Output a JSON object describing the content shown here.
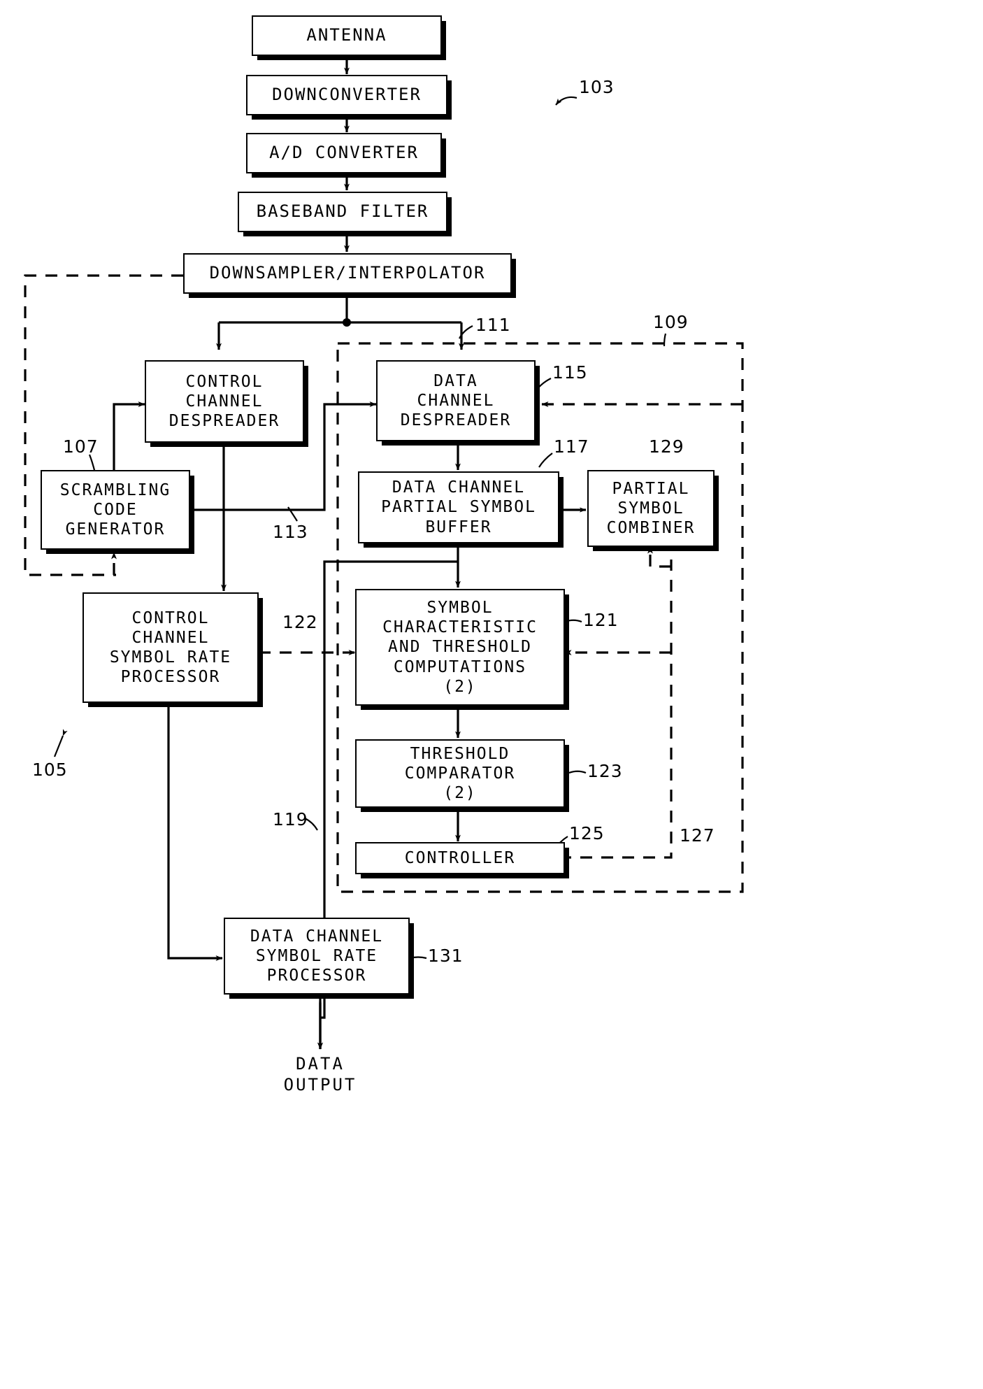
{
  "figure": {
    "title": "Receiver block diagram",
    "stroke_color": "#000000",
    "background_color": "#ffffff"
  },
  "blocks": [
    {
      "id": "antenna",
      "label": "ANTENNA"
    },
    {
      "id": "downconverter",
      "label": "DOWNCONVERTER"
    },
    {
      "id": "ad_converter",
      "label": "A/D CONVERTER"
    },
    {
      "id": "baseband_filter",
      "label": "BASEBAND FILTER"
    },
    {
      "id": "downsampler",
      "label": "DOWNSAMPLER/INTERPOLATOR"
    },
    {
      "id": "control_despreader",
      "label": "CONTROL\nCHANNEL\nDESPREADER"
    },
    {
      "id": "data_despreader",
      "label": "DATA\nCHANNEL\nDESPREADER"
    },
    {
      "id": "scrambling_code",
      "label": "SCRAMBLING\nCODE\nGENERATOR"
    },
    {
      "id": "partial_symbol_buffer",
      "label": "DATA CHANNEL\nPARTIAL SYMBOL\nBUFFER"
    },
    {
      "id": "partial_symbol_combiner",
      "label": "PARTIAL\nSYMBOL\nCOMBINER"
    },
    {
      "id": "control_symbol_rate",
      "label": "CONTROL\nCHANNEL\nSYMBOL RATE\nPROCESSOR"
    },
    {
      "id": "symbol_characteristic",
      "label": "SYMBOL\nCHARACTERISTIC\nAND THRESHOLD\nCOMPUTATIONS\n(2)"
    },
    {
      "id": "threshold_comparator",
      "label": "THRESHOLD\nCOMPARATOR\n(2)"
    },
    {
      "id": "controller",
      "label": "CONTROLLER"
    },
    {
      "id": "data_symbol_rate",
      "label": "DATA CHANNEL\nSYMBOL RATE\nPROCESSOR"
    }
  ],
  "reference_numerals": [
    {
      "id": "ref-103",
      "label": "103"
    },
    {
      "id": "ref-109",
      "label": "109"
    },
    {
      "id": "ref-111",
      "label": "111"
    },
    {
      "id": "ref-107",
      "label": "107"
    },
    {
      "id": "ref-115",
      "label": "115"
    },
    {
      "id": "ref-117",
      "label": "117"
    },
    {
      "id": "ref-129",
      "label": "129"
    },
    {
      "id": "ref-113",
      "label": "113"
    },
    {
      "id": "ref-122",
      "label": "122"
    },
    {
      "id": "ref-121",
      "label": "121"
    },
    {
      "id": "ref-105",
      "label": "105"
    },
    {
      "id": "ref-123",
      "label": "123"
    },
    {
      "id": "ref-119",
      "label": "119"
    },
    {
      "id": "ref-125",
      "label": "125"
    },
    {
      "id": "ref-127",
      "label": "127"
    },
    {
      "id": "ref-131",
      "label": "131"
    }
  ],
  "free_text": [
    {
      "id": "data-output",
      "label": "DATA\nOUTPUT"
    }
  ]
}
